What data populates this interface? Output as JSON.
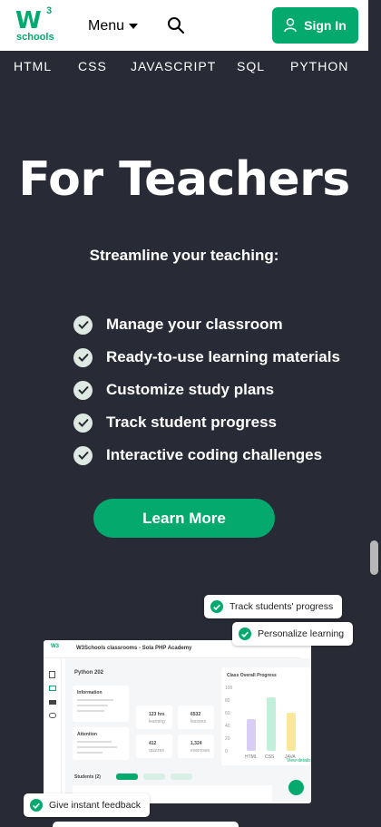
{
  "header": {
    "logo_mark": "W",
    "logo_sup": "3",
    "logo_sub": "schools",
    "menu_label": "Menu",
    "signin_label": "Sign In",
    "accent": "#04aa6d"
  },
  "subnav": [
    "HTML",
    "CSS",
    "JAVASCRIPT",
    "SQL",
    "PYTHON"
  ],
  "hero": {
    "title": "For Teachers",
    "subtitle": "Streamline your teaching:",
    "features": [
      "Manage your classroom",
      "Ready-to-use learning materials",
      "Customize study plans",
      "Track student progress",
      "Interactive coding challenges"
    ],
    "cta": "Learn More"
  },
  "preview": {
    "pills": [
      "Track students' progress",
      "Personalize learning",
      "Give instant feedback"
    ],
    "window_title": "W3Schools classrooms - Sola PHP Academy",
    "logo": "W3",
    "course": "Python 202",
    "info_heading": "Information",
    "attention_heading": "Attention",
    "stats": [
      {
        "value": "123 hrs",
        "label": "learning"
      },
      {
        "value": "6532",
        "label": "lessons"
      },
      {
        "value": "412",
        "label": "quizzes"
      },
      {
        "value": "1,324",
        "label": "exercises"
      }
    ],
    "progress_title": "Class Overall Progress",
    "progress_bars": [
      {
        "label": "HTML",
        "value": 50,
        "color": "#d9ccf5"
      },
      {
        "label": "CSS",
        "value": 85,
        "color": "#c2efd9"
      },
      {
        "label": "JAVA",
        "value": 60,
        "color": "#fbe79a"
      }
    ],
    "progress_ticks": [
      "100",
      "80",
      "60",
      "40",
      "20",
      "0"
    ],
    "view_details": "View details",
    "students_label": "Students (2)"
  }
}
